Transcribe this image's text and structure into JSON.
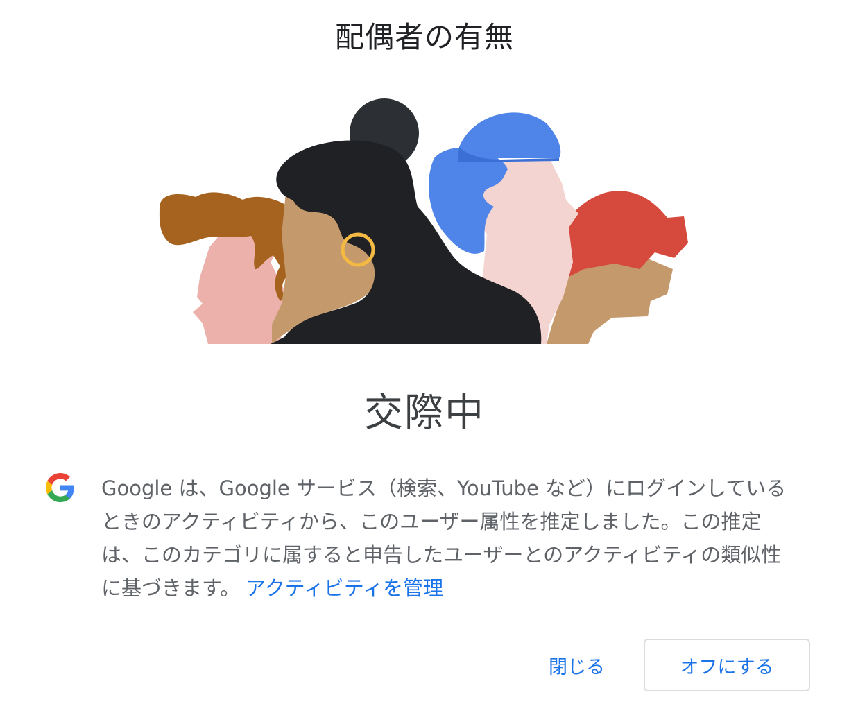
{
  "dialog": {
    "title": "配偶者の有無",
    "category_value": "交際中",
    "info": {
      "logo_icon": "google-g-icon",
      "text": "Google は、Google サービス（検索、YouTube など）にログインしているときのアクティビティから、このユーザー属性を推定しました。この推定は、このカテゴリに属すると申告したユーザーとのアクティビティの類似性に基づきます。",
      "link_label": "アクティビティを管理"
    },
    "actions": {
      "close_label": "閉じる",
      "turn_off_label": "オフにする"
    }
  },
  "colors": {
    "link_blue": "#1a73e8",
    "google_blue": "#4285f4",
    "google_red": "#ea4335",
    "google_yellow": "#fbbc05",
    "google_green": "#34a853"
  }
}
